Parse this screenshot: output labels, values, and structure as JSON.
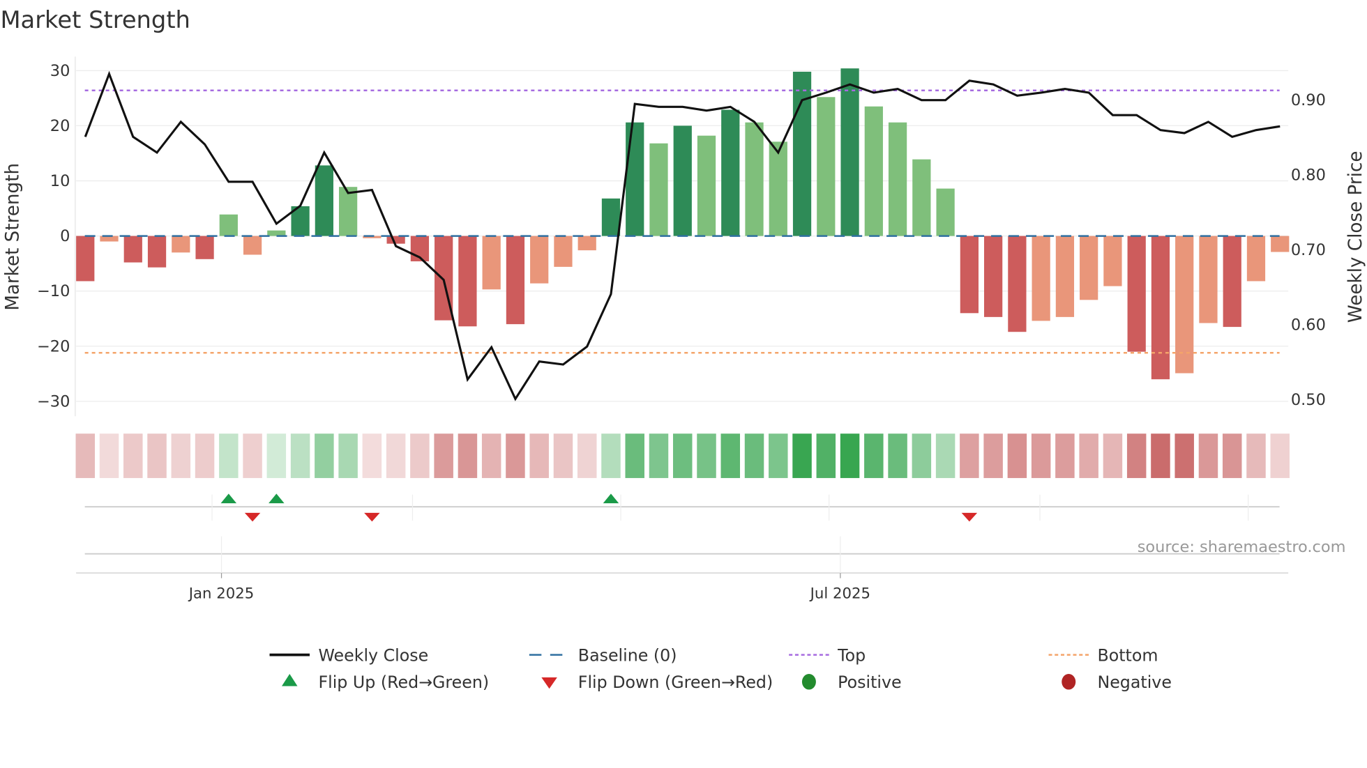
{
  "chart_data": {
    "type": "bar",
    "title": "Market Strength",
    "ylabel": "Market Strength",
    "y2label": "Weekly Close Price",
    "ylim": [
      -33,
      33
    ],
    "y2lim": [
      0.47,
      0.97
    ],
    "yticks": [
      30,
      20,
      10,
      0,
      -10,
      -20,
      -30
    ],
    "ytick_labels": [
      "30",
      "20",
      "10",
      "0",
      "−10",
      "−20",
      "−30"
    ],
    "y2ticks": [
      0.9,
      0.8,
      0.7,
      0.6,
      0.5
    ],
    "y2tick_labels": [
      "0.90",
      "0.80",
      "0.70",
      "0.60",
      "0.50"
    ],
    "xtick_labels": [
      {
        "label": "Jan 2025",
        "index": 5.7
      },
      {
        "label": "Jul 2025",
        "index": 31.6
      }
    ],
    "grid": true,
    "top_level": 26.4,
    "bottom_level": -21.2,
    "strength": [
      -8.2,
      -1,
      -4.8,
      -5.7,
      -3,
      -4.2,
      3.9,
      -3.4,
      1,
      5.4,
      12.8,
      8.9,
      -0.4,
      -1.4,
      -4.6,
      -15.3,
      -16.4,
      -9.7,
      -16,
      -8.6,
      -5.6,
      -2.6,
      6.8,
      20.6,
      16.8,
      20,
      18.2,
      22.9,
      20.6,
      17.1,
      29.8,
      25.2,
      30.4,
      23.5,
      20.6,
      13.9,
      8.6,
      -14,
      -14.7,
      -17.4,
      -15.4,
      -14.7,
      -11.6,
      -9.1,
      -21,
      -26,
      -24.9,
      -15.8,
      -16.5,
      -8.2,
      -2.9
    ],
    "weekly_close": [
      0.851,
      0.935,
      0.851,
      0.83,
      0.871,
      0.841,
      0.791,
      0.791,
      0.735,
      0.759,
      0.83,
      0.776,
      0.78,
      0.705,
      0.69,
      0.66,
      0.527,
      0.57,
      0.501,
      0.551,
      0.547,
      0.571,
      0.641,
      0.895,
      0.891,
      0.891,
      0.886,
      0.891,
      0.871,
      0.83,
      0.9,
      0.91,
      0.921,
      0.91,
      0.915,
      0.9,
      0.9,
      0.926,
      0.921,
      0.906,
      0.91,
      0.915,
      0.91,
      0.88,
      0.88,
      0.86,
      0.856,
      0.871,
      0.851,
      0.86,
      0.865
    ],
    "flip_up_indices": [
      6,
      8,
      22
    ],
    "flip_down_indices": [
      7,
      12,
      37
    ],
    "legend": [
      {
        "label": "Weekly Close",
        "kind": "line",
        "color": "#111111"
      },
      {
        "label": "Baseline (0)",
        "kind": "dashed",
        "color": "#2f6fa0"
      },
      {
        "label": "Top",
        "kind": "dotted",
        "color": "#a66be0"
      },
      {
        "label": "Bottom",
        "kind": "dotted",
        "color": "#f4a46a"
      },
      {
        "label": "Flip Up (Red→Green)",
        "kind": "tri-up",
        "color": "#1a9a48"
      },
      {
        "label": "Flip Down (Green→Red)",
        "kind": "tri-down",
        "color": "#d62828"
      },
      {
        "label": "Positive",
        "kind": "dot",
        "color": "#238b2e"
      },
      {
        "label": "Negative",
        "kind": "dot",
        "color": "#b02424"
      }
    ],
    "legend_position": "bottom",
    "colors": {
      "pos_strong": "#2e8b57",
      "pos_weak": "#7fbf7b",
      "neg_strong": "#cd5c5c",
      "neg_weak": "#e9967a"
    }
  },
  "source": "source: sharemaestro.com"
}
